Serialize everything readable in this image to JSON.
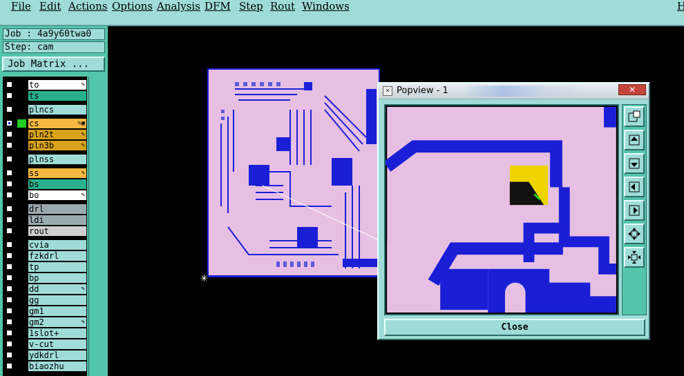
{
  "menu": [
    "File",
    "Edit",
    "Actions",
    "Options",
    "Analysis",
    "DFM",
    "Step",
    "Rout",
    "Windows",
    "H"
  ],
  "job": "Job : 4a9y60twa0",
  "step": "Step: cam",
  "job_matrix_label": "Job Matrix ...",
  "layers": [
    {
      "name": "to",
      "bg": "#ffffff",
      "checked": false,
      "bar": "#000000",
      "icon": "✎"
    },
    {
      "name": "ts",
      "bg": "#2bb08f",
      "checked": false,
      "bar": "#000000",
      "icon": ""
    },
    {
      "name": "plncs",
      "bg": "#9fdcd8",
      "checked": false,
      "bar": "#000000",
      "icon": ""
    },
    {
      "name": "cs",
      "bg": "#f5b942",
      "checked": true,
      "bar": "#22cc22",
      "icon": "✎▣"
    },
    {
      "name": "pln2t",
      "bg": "#d9a21b",
      "checked": false,
      "bar": "#000000",
      "icon": "✎"
    },
    {
      "name": "pln3b",
      "bg": "#d9a21b",
      "checked": false,
      "bar": "#000000",
      "icon": "✎"
    },
    {
      "name": "plnss",
      "bg": "#9fdcd8",
      "checked": false,
      "bar": "#000000",
      "icon": ""
    },
    {
      "name": "ss",
      "bg": "#f5b942",
      "checked": false,
      "bar": "#000000",
      "icon": "✎"
    },
    {
      "name": "bs",
      "bg": "#2bb08f",
      "checked": false,
      "bar": "#000000",
      "icon": ""
    },
    {
      "name": "bo",
      "bg": "#ffffff",
      "checked": false,
      "bar": "#000000",
      "icon": "✎"
    },
    {
      "name": "drl",
      "bg": "#9aabb0",
      "checked": false,
      "bar": "#000000",
      "icon": ""
    },
    {
      "name": "ldi",
      "bg": "#9aabb0",
      "checked": false,
      "bar": "#000000",
      "icon": ""
    },
    {
      "name": "rout",
      "bg": "#d0d0d0",
      "checked": false,
      "bar": "#000000",
      "icon": ""
    },
    {
      "name": "cvia",
      "bg": "#9fdcd8",
      "checked": false,
      "bar": "#000000",
      "icon": ""
    },
    {
      "name": "fzkdrl",
      "bg": "#9fdcd8",
      "checked": false,
      "bar": "#000000",
      "icon": ""
    },
    {
      "name": "tp",
      "bg": "#9fdcd8",
      "checked": false,
      "bar": "#000000",
      "icon": ""
    },
    {
      "name": "bp",
      "bg": "#9fdcd8",
      "checked": false,
      "bar": "#000000",
      "icon": ""
    },
    {
      "name": "dd",
      "bg": "#9fdcd8",
      "checked": false,
      "bar": "#000000",
      "icon": "✎"
    },
    {
      "name": "gg",
      "bg": "#9fdcd8",
      "checked": false,
      "bar": "#000000",
      "icon": ""
    },
    {
      "name": "gm1",
      "bg": "#9fdcd8",
      "checked": false,
      "bar": "#000000",
      "icon": ""
    },
    {
      "name": "gm2",
      "bg": "#9fdcd8",
      "checked": false,
      "bar": "#000000",
      "icon": "✎"
    },
    {
      "name": "1slot+",
      "bg": "#9fdcd8",
      "checked": false,
      "bar": "#000000",
      "icon": ""
    },
    {
      "name": "v-cut",
      "bg": "#9fdcd8",
      "checked": false,
      "bar": "#000000",
      "icon": ""
    },
    {
      "name": "ydkdrl",
      "bg": "#9fdcd8",
      "checked": false,
      "bar": "#000000",
      "icon": ""
    },
    {
      "name": "biaozhu",
      "bg": "#9fdcd8",
      "checked": false,
      "bar": "#000000",
      "icon": ""
    }
  ],
  "popview": {
    "title": "Popview - 1",
    "close_x": "✕",
    "close_label": "Close",
    "tools": [
      "zoom-fit-icon",
      "pan-up-icon",
      "pan-down-icon",
      "pan-left-icon",
      "pan-right-icon",
      "zoom-in-icon",
      "zoom-out-icon"
    ]
  },
  "colors": {
    "ui_teal": "#9fdcd8",
    "panel_green": "#53c5ab",
    "pcb_pink": "#e6bfe3",
    "trace_blue": "#1a1fd6",
    "highlight_yellow": "#f0d400"
  }
}
